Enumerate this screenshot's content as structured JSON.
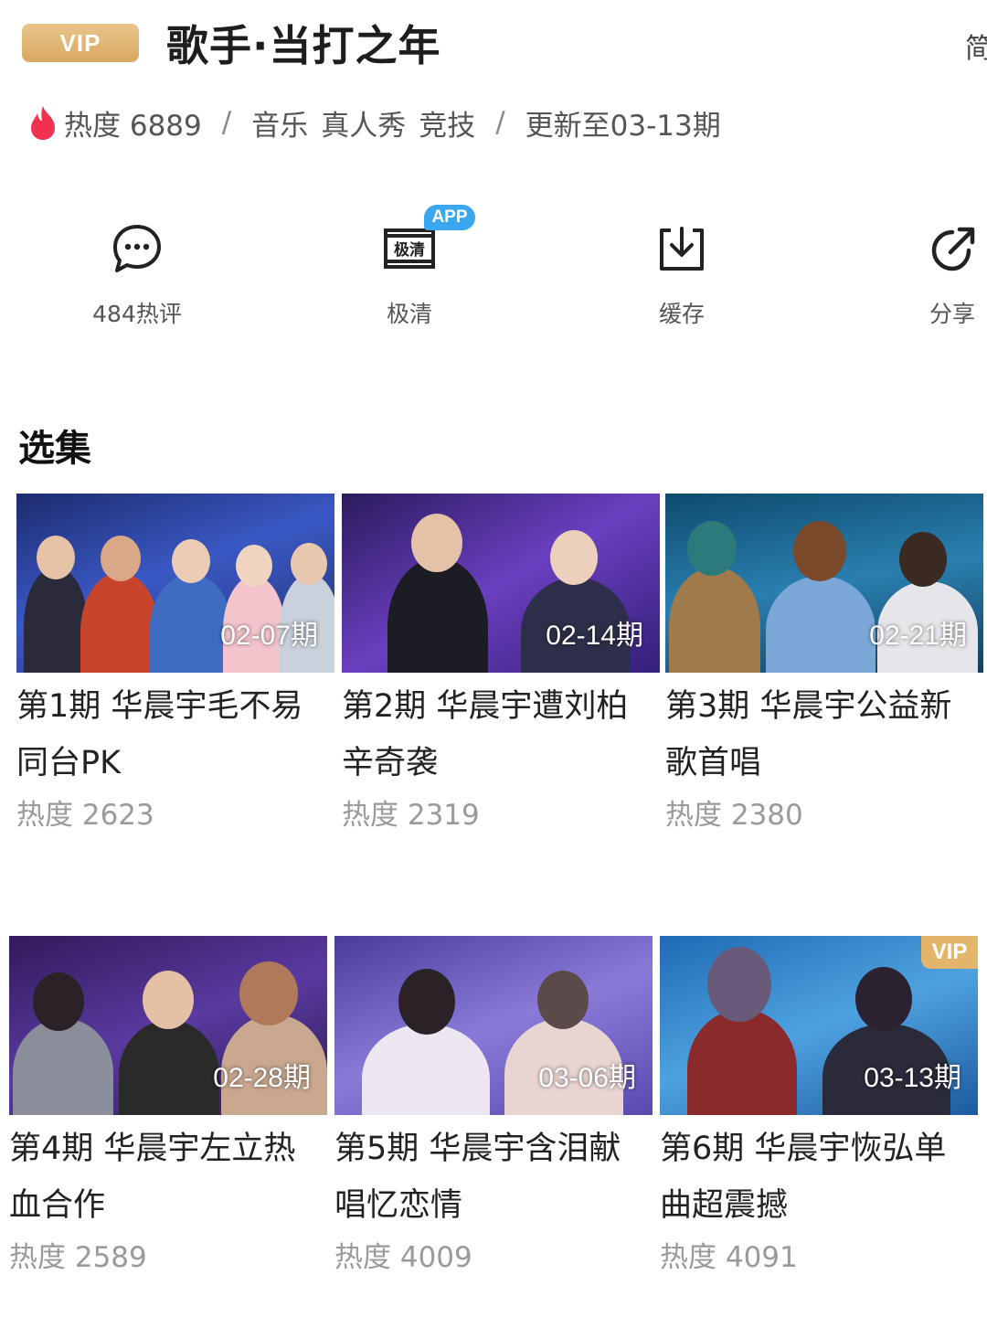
{
  "header": {
    "vip_label": "VIP",
    "title": "歌手·当打之年",
    "lang_toggle": "简"
  },
  "meta": {
    "heat_label": "热度 6889",
    "separator": "/",
    "tags": [
      "音乐",
      "真人秀",
      "竞技"
    ],
    "update_text": "更新至03-13期"
  },
  "actions": [
    {
      "label": "484热评",
      "icon": "comment-icon"
    },
    {
      "label": "极清",
      "icon": "hd-icon",
      "badge": "APP",
      "icon_text": "极清"
    },
    {
      "label": "缓存",
      "icon": "download-icon"
    },
    {
      "label": "分享",
      "icon": "share-icon"
    }
  ],
  "section": {
    "title": "选集"
  },
  "episodes": [
    {
      "title": "第1期 华晨宇毛不易同台PK",
      "heat": "热度 2623",
      "date": "02-07期",
      "vip": false
    },
    {
      "title": "第2期 华晨宇遭刘柏辛奇袭",
      "heat": "热度 2319",
      "date": "02-14期",
      "vip": false
    },
    {
      "title": "第3期 华晨宇公益新歌首唱",
      "heat": "热度 2380",
      "date": "02-21期",
      "vip": false
    },
    {
      "title": "第4期 华晨宇左立热血合作",
      "heat": "热度 2589",
      "date": "02-28期",
      "vip": false
    },
    {
      "title": "第5期 华晨宇含泪献唱忆恋情",
      "heat": "热度 4009",
      "date": "03-06期",
      "vip": false
    },
    {
      "title": "第6期 华晨宇恢弘单曲超震撼",
      "heat": "热度 4091",
      "date": "03-13期",
      "vip": true,
      "vip_label": "VIP"
    }
  ],
  "colors": {
    "vip_gold": "#d9a862",
    "flame_red": "#f2304f",
    "app_blue": "#3aa7f0",
    "heat_gray": "#9a9a9a"
  }
}
